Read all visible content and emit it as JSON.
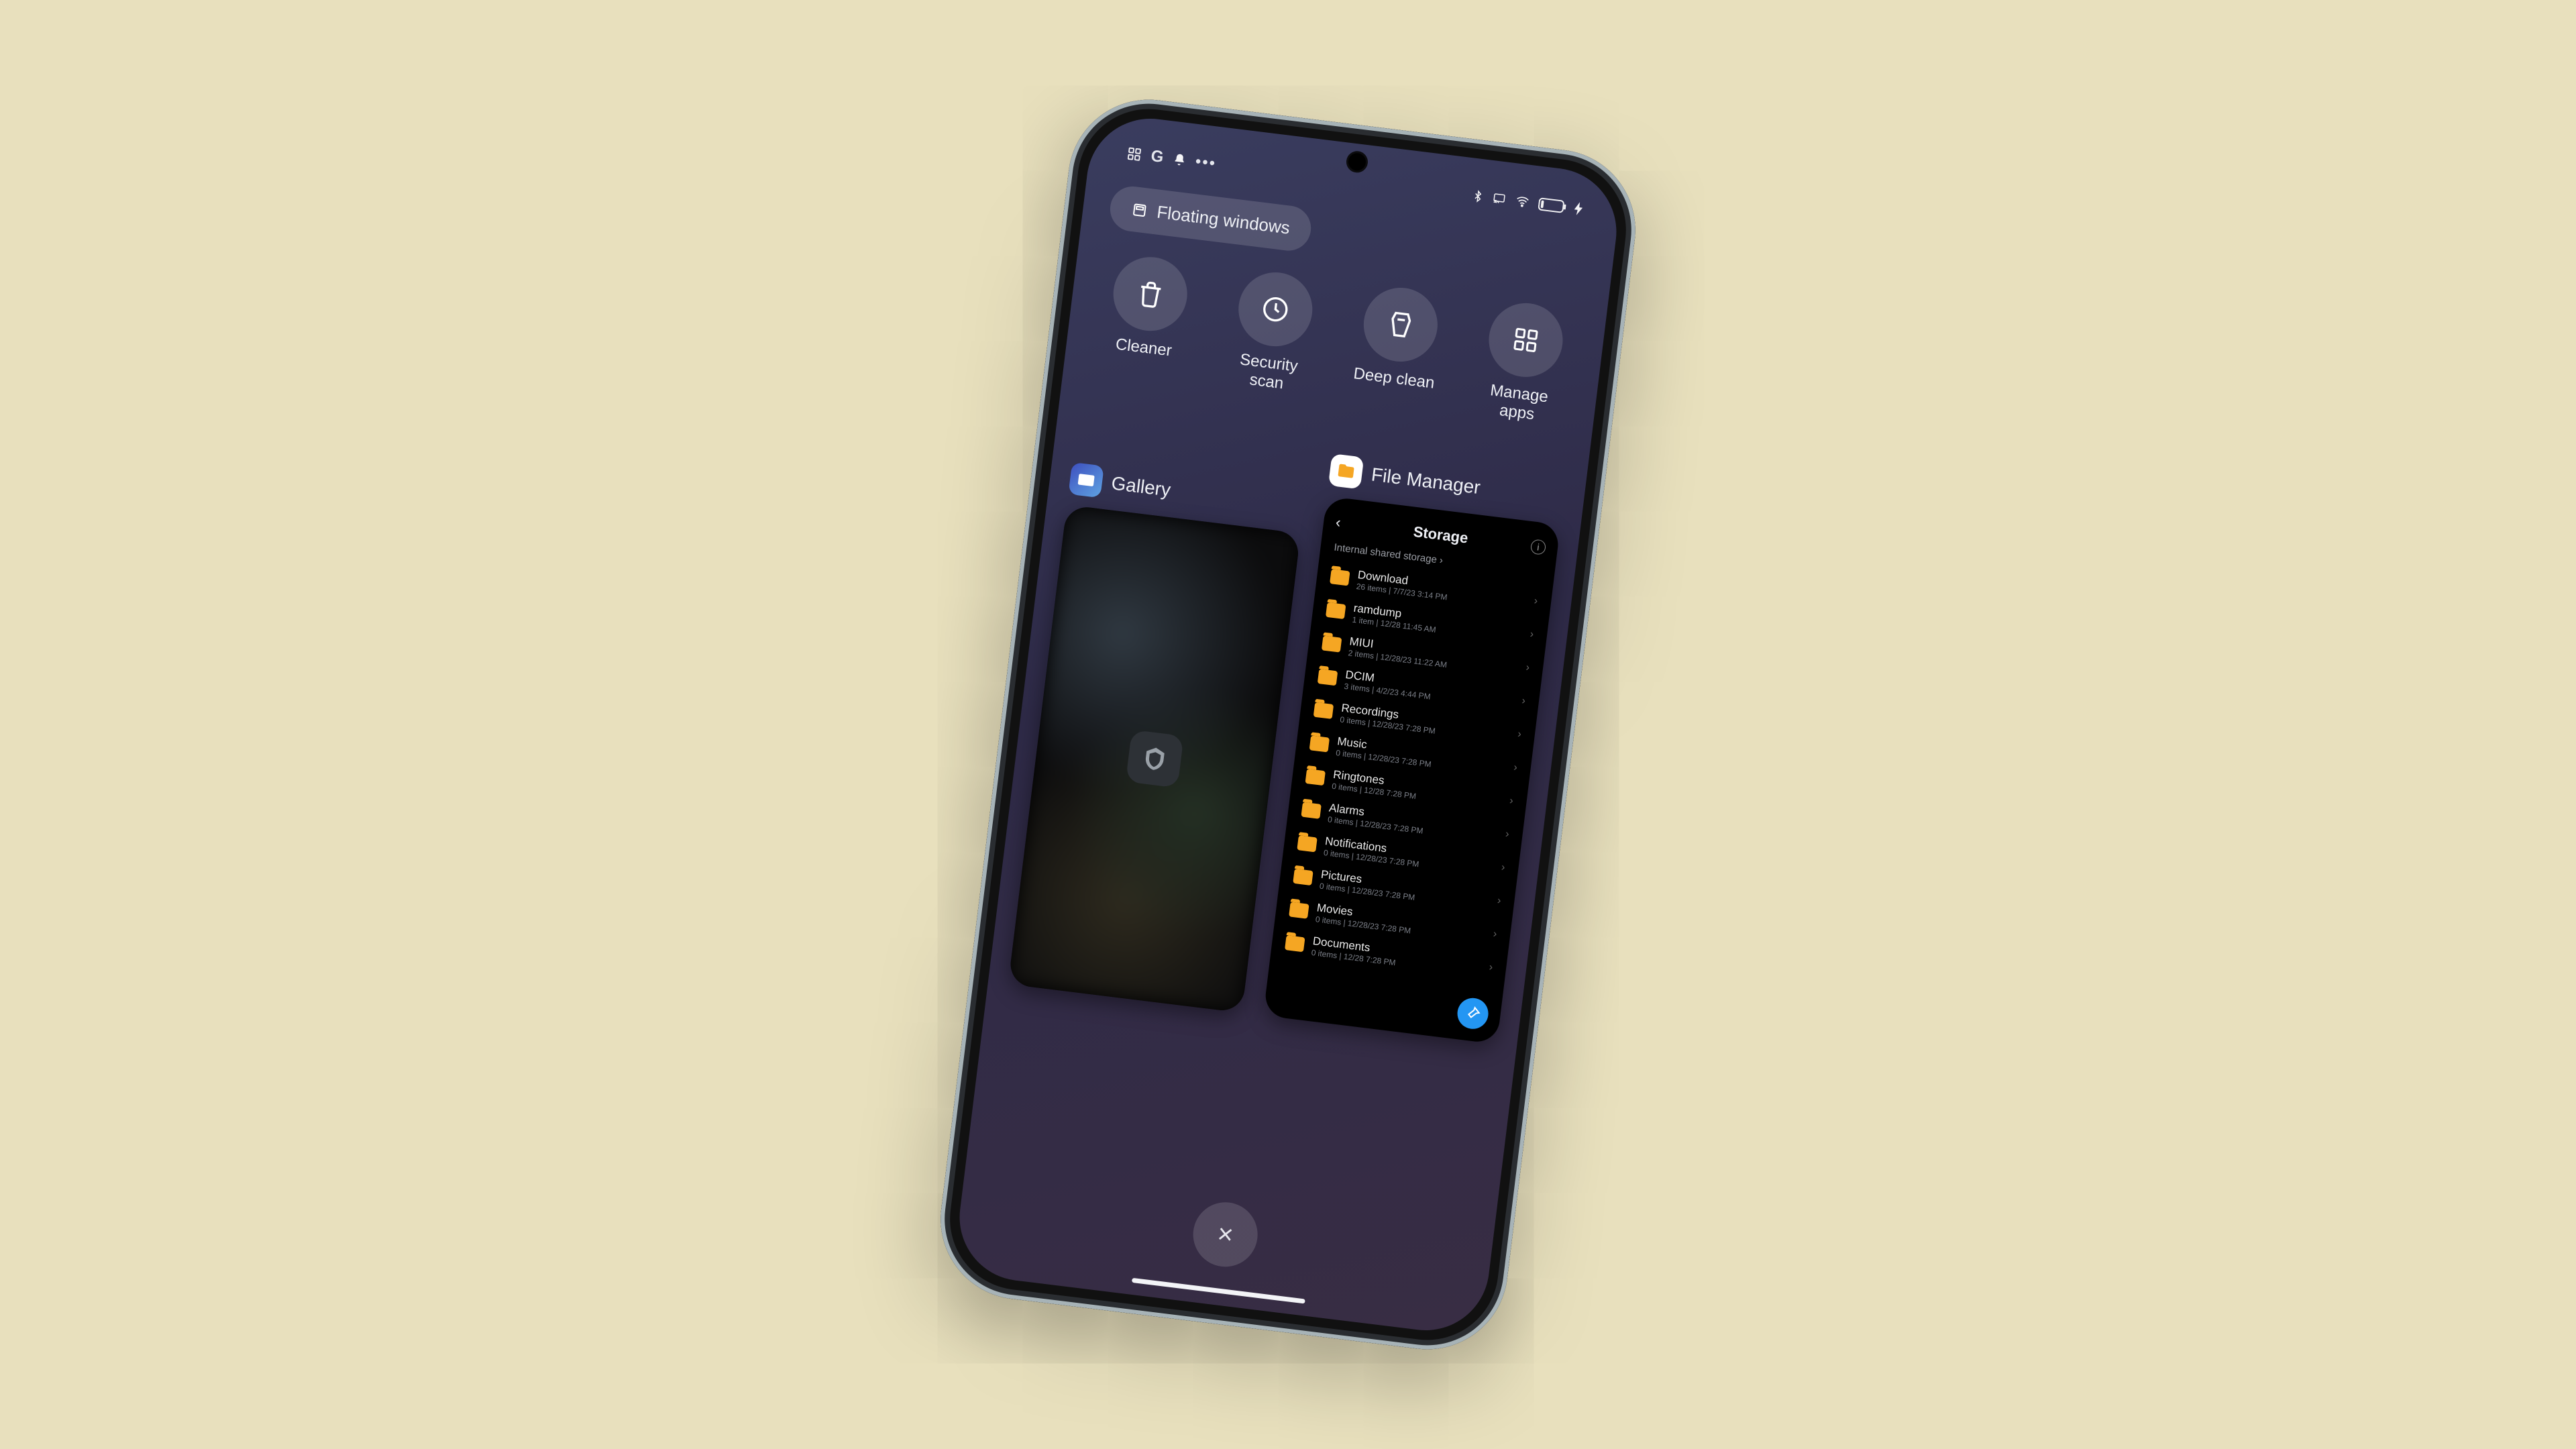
{
  "statusbar": {
    "left_icons": [
      "widgets-icon",
      "google-icon",
      "bell-icon",
      "more-icon"
    ],
    "right_icons": [
      "bluetooth-icon",
      "cast-icon",
      "wifi-icon",
      "battery-icon",
      "charging-icon"
    ],
    "battery_text": "2"
  },
  "floating_pill": {
    "label": "Floating windows"
  },
  "shortcuts": [
    {
      "id": "cleaner",
      "label": "Cleaner",
      "icon": "trash-icon"
    },
    {
      "id": "security-scan",
      "label": "Security\nscan",
      "icon": "scan-icon"
    },
    {
      "id": "deep-clean",
      "label": "Deep clean",
      "icon": "broom-icon"
    },
    {
      "id": "manage-apps",
      "label": "Manage\napps",
      "icon": "grid-icon"
    }
  ],
  "recent_cards": {
    "gallery": {
      "label": "Gallery"
    },
    "file_manager": {
      "label": "File Manager"
    }
  },
  "file_manager": {
    "title": "Storage",
    "breadcrumb": "Internal shared storage ›",
    "items": [
      {
        "name": "Download",
        "meta": "26 items | 7/7/23 3:14 PM"
      },
      {
        "name": "ramdump",
        "meta": "1 item | 12/28 11:45 AM"
      },
      {
        "name": "MIUI",
        "meta": "2 items | 12/28/23 11:22 AM"
      },
      {
        "name": "DCIM",
        "meta": "3 items | 4/2/23 4:44 PM"
      },
      {
        "name": "Recordings",
        "meta": "0 items | 12/28/23 7:28 PM"
      },
      {
        "name": "Music",
        "meta": "0 items | 12/28/23 7:28 PM"
      },
      {
        "name": "Ringtones",
        "meta": "0 items | 12/28 7:28 PM"
      },
      {
        "name": "Alarms",
        "meta": "0 items | 12/28/23 7:28 PM"
      },
      {
        "name": "Notifications",
        "meta": "0 items | 12/28/23 7:28 PM"
      },
      {
        "name": "Pictures",
        "meta": "0 items | 12/28/23 7:28 PM"
      },
      {
        "name": "Movies",
        "meta": "0 items | 12/28/23 7:28 PM"
      },
      {
        "name": "Documents",
        "meta": "0 items | 12/28 7:28 PM"
      }
    ]
  },
  "close_all": {
    "label": "×"
  }
}
